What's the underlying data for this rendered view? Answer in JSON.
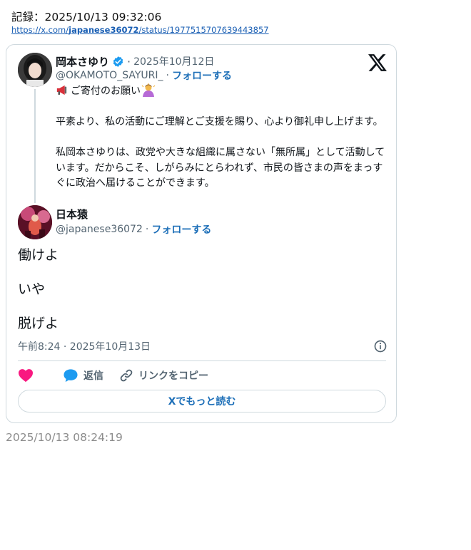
{
  "record": {
    "line": "記録：2025/10/13 09:32:06",
    "url_prefix": "https://x.com/",
    "url_user": "japanese36072",
    "url_suffix": "/status/1977515707639443857"
  },
  "card": {
    "logo_icon": "x-logo-icon",
    "quoted": {
      "name": "岡本さゆり",
      "verified": true,
      "verified_color": "#1d9bf0",
      "date": "2025年10月12日",
      "handle": "@OKAMOTO_SAYURI_",
      "follow_label": "フォローする",
      "line1_text": "ご寄付のお願い",
      "line1_icons": [
        "megaphone-icon",
        "bowing-person-icon"
      ],
      "paragraph2": "平素より、私の活動にご理解とご支援を賜り、心より御礼申し上げます。",
      "paragraph3": "私岡本さゆりは、政党や大きな組織に属さない「無所属」として活動しています。だからこそ、しがらみにとらわれず、市民の皆さまの声をまっすぐに政治へ届けることができます。"
    },
    "main": {
      "name": "日本猿",
      "handle": "@japanese36072",
      "follow_label": "フォローする",
      "lines": [
        "働けよ",
        "いや",
        "脱げよ"
      ],
      "timestamp": "午前8:24 · 2025年10月13日",
      "info_icon": "info-icon"
    },
    "actions": {
      "like_icon": "heart-icon",
      "like_color": "#f91880",
      "reply_icon": "reply-bubble-icon",
      "reply_label": "返信",
      "copy_icon": "link-icon",
      "copy_label": "リンクをコピー"
    },
    "read_more_label": "Xでもっと読む",
    "accent_color": "#1d6fb8"
  },
  "footer_timestamp": "2025/10/13 08:24:19"
}
